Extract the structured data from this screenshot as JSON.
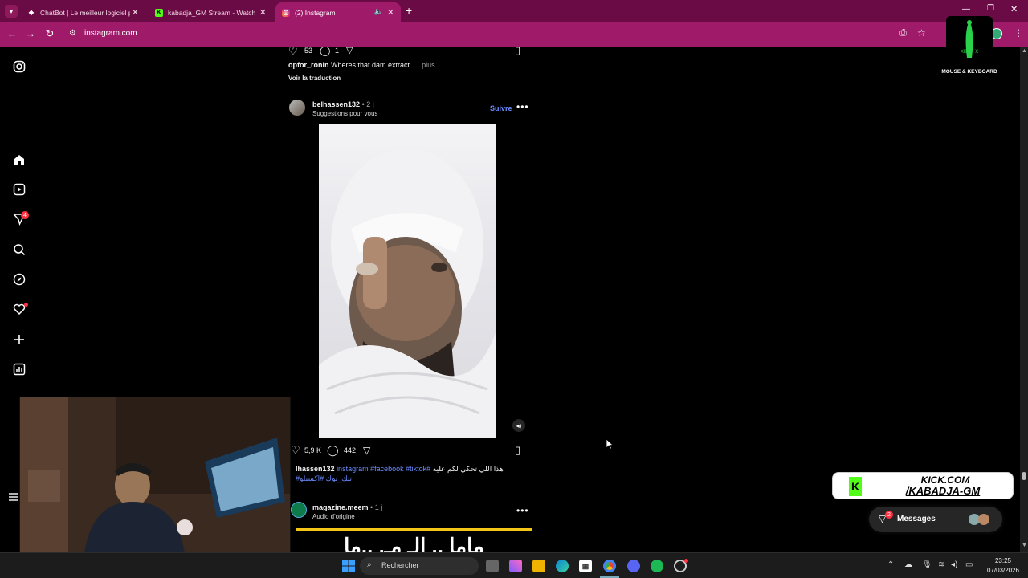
{
  "browser": {
    "tabs": [
      {
        "title": "ChatBot | Le meilleur logiciel p",
        "active": false
      },
      {
        "title": "kabadja_GM Stream - Watch Li",
        "active": false
      },
      {
        "title": "(2) Instagram",
        "active": true
      }
    ],
    "new_tab": "+",
    "url": "instagram.com"
  },
  "sidebar": {
    "notifications_badge": "4"
  },
  "post_prev": {
    "likes": "53",
    "comments": "1",
    "username": "opfor_ronin",
    "caption": "Wheres that dam extract.....",
    "more": "plus",
    "translate": "Voir la traduction"
  },
  "post_main": {
    "username": "belhassen132",
    "time": "• 2 j",
    "subtitle": "Suggestions pour vous",
    "follow": "Suivre",
    "likes": "5,9 K",
    "comments": "442",
    "caption_user": "lhassen132",
    "caption_tags": "instagram #facebook #tiktok#",
    "caption_arabic": "هذا اللي تحكي لكم عليه",
    "caption_line2": "#تيك_توك #اكسبلو"
  },
  "post_next": {
    "username": "magazine.meem",
    "time": "• 1 j",
    "subtitle": "Audio d'origine",
    "banner_text": "ماما .. الـ مـ. ..ما"
  },
  "messages": {
    "label": "Messages",
    "badge": "2"
  },
  "overlay": {
    "kick_line1": "KICK.COM",
    "kick_line2": "/KABADJA-GM",
    "xbox_line1": "XBOX X",
    "xbox_line2": "MOUSE & KEYBOARD"
  },
  "taskbar": {
    "search_placeholder": "Rechercher",
    "time": "23:25",
    "date": "07/03/2026"
  },
  "colors": {
    "tabbar": "#6b0b45",
    "addressbar": "#a01a6a",
    "link": "#6c8cff",
    "badge": "#ff3040"
  }
}
